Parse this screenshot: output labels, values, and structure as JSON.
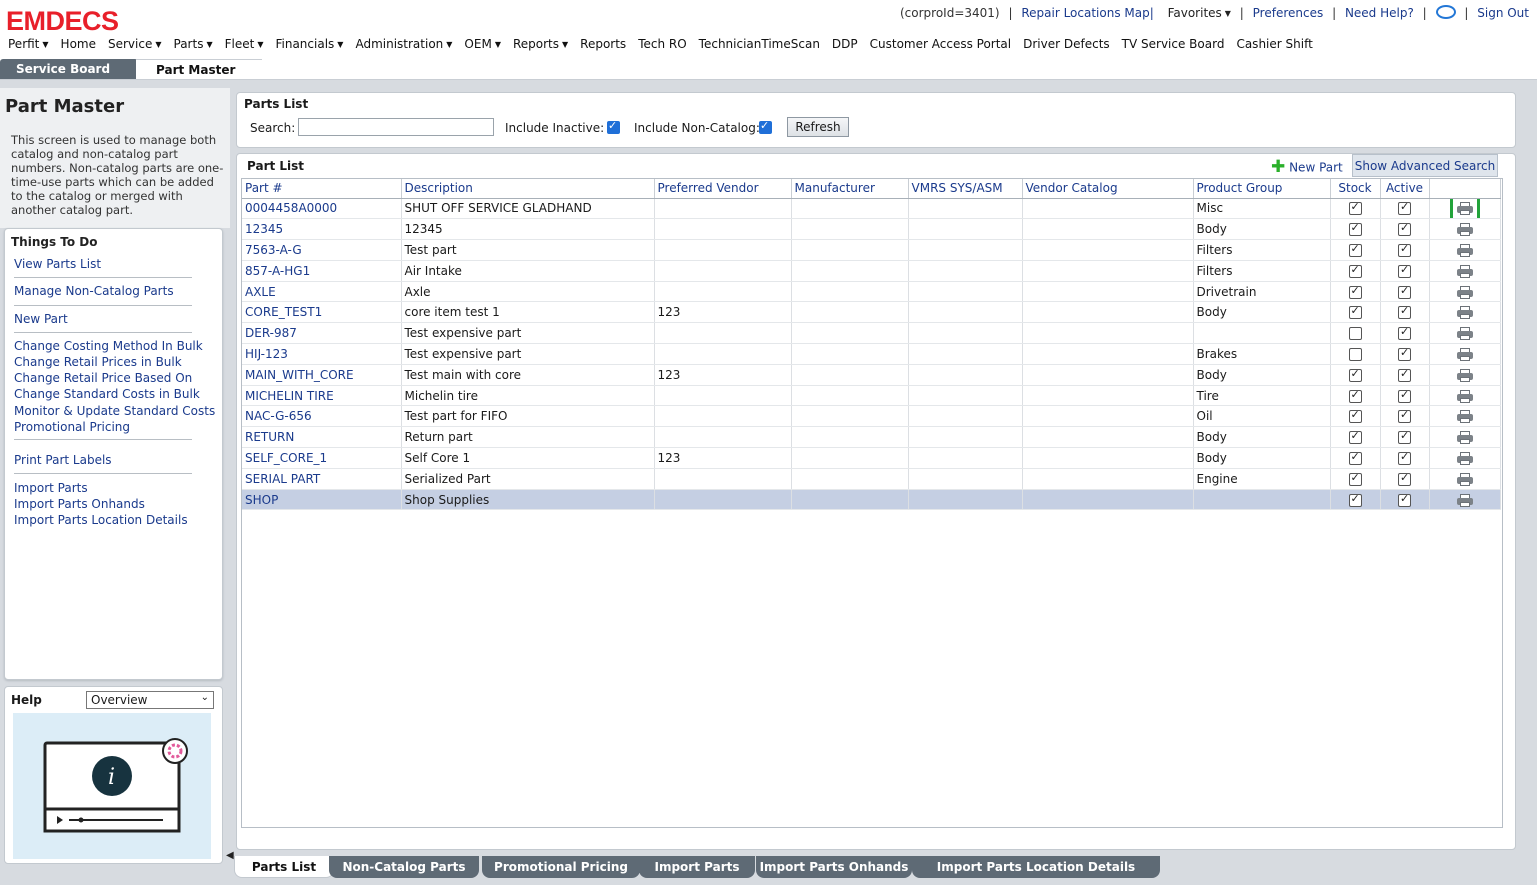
{
  "header": {
    "logo": "EMDECS",
    "corp_id": "(corproId=3401)",
    "repair_map": "Repair Locations Map|",
    "favorites": "Favorites",
    "preferences": "Preferences",
    "help": "Need Help?",
    "signout": "Sign Out"
  },
  "menu": [
    {
      "label": "Perfit",
      "dropdown": true
    },
    {
      "label": "Home",
      "dropdown": false
    },
    {
      "label": "Service",
      "dropdown": true
    },
    {
      "label": "Parts",
      "dropdown": true
    },
    {
      "label": "Fleet",
      "dropdown": true
    },
    {
      "label": "Financials",
      "dropdown": true
    },
    {
      "label": "Administration",
      "dropdown": true
    },
    {
      "label": "OEM",
      "dropdown": true
    },
    {
      "label": "Reports",
      "dropdown": true
    },
    {
      "label": "Reports",
      "dropdown": false
    },
    {
      "label": "Tech RO",
      "dropdown": false
    },
    {
      "label": "TechnicianTimeScan",
      "dropdown": false
    },
    {
      "label": "DDP",
      "dropdown": false
    },
    {
      "label": "Customer Access Portal",
      "dropdown": false
    },
    {
      "label": "Driver Defects",
      "dropdown": false
    },
    {
      "label": "TV Service Board",
      "dropdown": false
    },
    {
      "label": "Cashier Shift",
      "dropdown": false
    }
  ],
  "top_tabs": {
    "service_board": "Service Board",
    "part_master": "Part Master"
  },
  "left": {
    "title": "Part Master",
    "description": "This screen is used to manage both catalog and non-catalog part numbers. Non-catalog parts are one-time-use parts which can be added to the catalog or merged with another catalog part.",
    "todo_title": "Things To Do",
    "todo_links": [
      "View Parts List",
      "Manage Non-Catalog Parts",
      "New Part",
      "Change Costing Method In Bulk",
      "Change Retail Prices in Bulk",
      "Change Retail Price Based On",
      "Change Standard Costs in Bulk",
      "Monitor & Update Standard Costs",
      "Promotional Pricing",
      "Print Part Labels",
      "Import Parts",
      "Import Parts Onhands",
      "Import Parts Location Details"
    ],
    "help_title": "Help",
    "help_selected": "Overview"
  },
  "filter": {
    "title": "Parts List",
    "search_label": "Search:",
    "search_value": "",
    "include_inactive_label": "Include Inactive:",
    "include_inactive": true,
    "include_noncatalog_label": "Include Non-Catalog:",
    "include_noncatalog": true,
    "refresh_label": "Refresh"
  },
  "grid": {
    "title": "Part List",
    "new_part_label": "New Part",
    "advanced_search_label": "Show Advanced Search",
    "columns": [
      "Part #",
      "Description",
      "Preferred Vendor",
      "Manufacturer",
      "VMRS SYS/ASM",
      "Vendor Catalog",
      "Product Group",
      "Stock",
      "Active"
    ],
    "rows": [
      {
        "part": "0004458A0000",
        "desc": "SHUT OFF SERVICE GLADHAND",
        "vendor": "",
        "mfr": "",
        "vmrs": "",
        "catalog": "",
        "group": "Misc",
        "stock": true,
        "active": true
      },
      {
        "part": "12345",
        "desc": "12345",
        "vendor": "",
        "mfr": "",
        "vmrs": "",
        "catalog": "",
        "group": "Body",
        "stock": true,
        "active": true
      },
      {
        "part": "7563-A-G",
        "desc": "Test part",
        "vendor": "",
        "mfr": "",
        "vmrs": "",
        "catalog": "",
        "group": "Filters",
        "stock": true,
        "active": true
      },
      {
        "part": "857-A-HG1",
        "desc": "Air Intake",
        "vendor": "",
        "mfr": "",
        "vmrs": "",
        "catalog": "",
        "group": "Filters",
        "stock": true,
        "active": true
      },
      {
        "part": "AXLE",
        "desc": "Axle",
        "vendor": "",
        "mfr": "",
        "vmrs": "",
        "catalog": "",
        "group": "Drivetrain",
        "stock": true,
        "active": true
      },
      {
        "part": "CORE_TEST1",
        "desc": "core item test 1",
        "vendor": "123",
        "mfr": "",
        "vmrs": "",
        "catalog": "",
        "group": "Body",
        "stock": true,
        "active": true
      },
      {
        "part": "DER-987",
        "desc": "Test expensive part",
        "vendor": "",
        "mfr": "",
        "vmrs": "",
        "catalog": "",
        "group": "",
        "stock": false,
        "active": true
      },
      {
        "part": "HIJ-123",
        "desc": "Test expensive part",
        "vendor": "",
        "mfr": "",
        "vmrs": "",
        "catalog": "",
        "group": "Brakes",
        "stock": false,
        "active": true
      },
      {
        "part": "MAIN_WITH_CORE",
        "desc": "Test main with core",
        "vendor": "123",
        "mfr": "",
        "vmrs": "",
        "catalog": "",
        "group": "Body",
        "stock": true,
        "active": true
      },
      {
        "part": "MICHELIN TIRE",
        "desc": "Michelin tire",
        "vendor": "",
        "mfr": "",
        "vmrs": "",
        "catalog": "",
        "group": "Tire",
        "stock": true,
        "active": true
      },
      {
        "part": "NAC-G-656",
        "desc": "Test part for FIFO",
        "vendor": "",
        "mfr": "",
        "vmrs": "",
        "catalog": "",
        "group": "Oil",
        "stock": true,
        "active": true
      },
      {
        "part": "RETURN",
        "desc": "Return part",
        "vendor": "",
        "mfr": "",
        "vmrs": "",
        "catalog": "",
        "group": "Body",
        "stock": true,
        "active": true
      },
      {
        "part": "SELF_CORE_1",
        "desc": "Self Core 1",
        "vendor": "123",
        "mfr": "",
        "vmrs": "",
        "catalog": "",
        "group": "Body",
        "stock": true,
        "active": true
      },
      {
        "part": "SERIAL PART",
        "desc": "Serialized Part",
        "vendor": "",
        "mfr": "",
        "vmrs": "",
        "catalog": "",
        "group": "Engine",
        "stock": true,
        "active": true
      },
      {
        "part": "SHOP",
        "desc": "Shop Supplies",
        "vendor": "",
        "mfr": "",
        "vmrs": "",
        "catalog": "",
        "group": "",
        "stock": true,
        "active": true,
        "selected": true
      }
    ]
  },
  "bottom_tabs": [
    "Parts List",
    "Non-Catalog Parts",
    "Promotional Pricing",
    "Import Parts",
    "Import Parts Onhands",
    "Import Parts Location Details"
  ],
  "colors": {
    "logo": "#e8202a",
    "link": "#1a3a8c",
    "tab_dark": "#5e6a75",
    "selected_row": "#c5cfe3",
    "highlight": "#22a33a"
  }
}
